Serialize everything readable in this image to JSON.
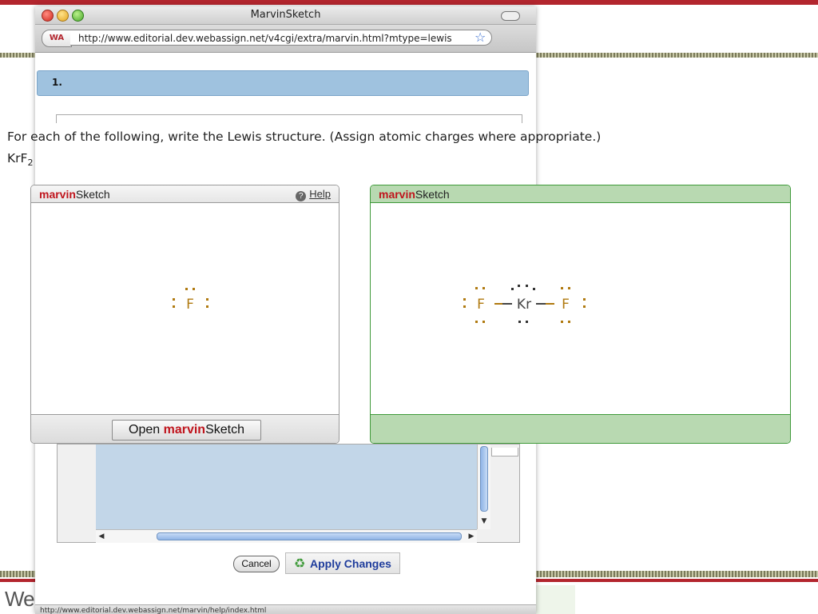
{
  "window": {
    "title": "MarvinSketch",
    "url": "http://www.editorial.dev.webassign.net/v4cgi/extra/marvin.html?mtype=lewis",
    "wa_badge": "WA",
    "status_url": "http://www.editorial.dev.webassign.net/marvin/help/index.html"
  },
  "question": {
    "number": "1.",
    "prompt": "For each of the following, write the Lewis structure. (Assign atomic charges where appropriate.)",
    "formula_base": "KrF",
    "formula_sub": "2"
  },
  "left_panel": {
    "brand_bold": "marvin",
    "brand_rest": "Sketch",
    "help_label": "Help",
    "open_button_prefix": "Open ",
    "open_button_bold": "marvin",
    "open_button_rest": "Sketch",
    "atom": "F"
  },
  "right_panel": {
    "brand_bold": "marvin",
    "brand_rest": "Sketch",
    "atoms": [
      "F",
      "Kr",
      "F"
    ]
  },
  "footer": {
    "cancel_label": "Cancel",
    "apply_label": "Apply Changes",
    "logo_text": "We"
  },
  "colors": {
    "brand_red": "#c0151d",
    "fluorine": "#b07a10",
    "krypton": "#444444",
    "question_bar": "#9fc2df",
    "panel_green": "#b8d9b1"
  }
}
